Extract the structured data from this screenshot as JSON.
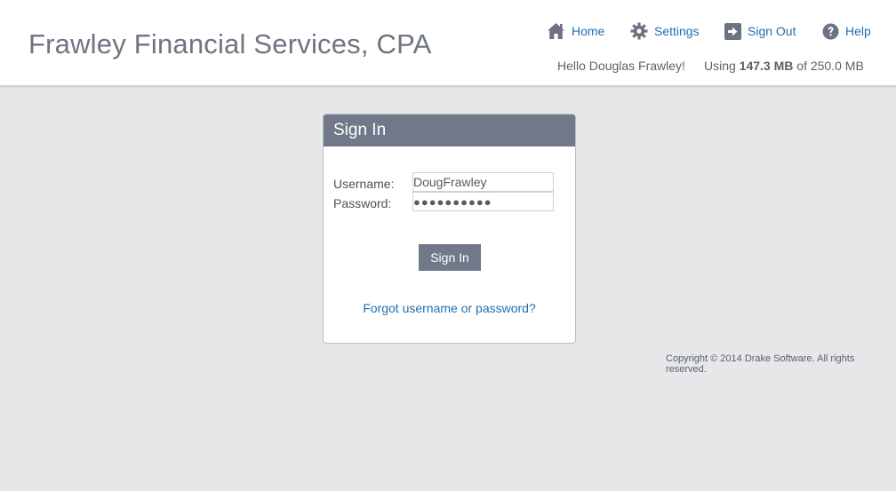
{
  "header": {
    "firm_name": "Frawley Financial Services, CPA",
    "greeting": "Hello Douglas Frawley!",
    "usage": {
      "prefix": "Using",
      "used": "147.3 MB",
      "middle": "of",
      "total": "250.0 MB"
    }
  },
  "nav": {
    "home": {
      "label": "Home",
      "icon": "home-icon"
    },
    "settings": {
      "label": "Settings",
      "icon": "gear-icon"
    },
    "signout": {
      "label": "Sign Out",
      "icon": "sign-out-icon"
    },
    "help": {
      "label": "Help",
      "icon": "help-icon"
    }
  },
  "signin": {
    "title": "Sign In",
    "username_label": "Username:",
    "username_value": "DougFrawley",
    "password_label": "Password:",
    "password_value": "●●●●●●●●●●",
    "button_label": "Sign In",
    "forgot_link": "Forgot username or password?"
  },
  "footer": {
    "copyright": "Copyright © 2014 Drake Software. All rights reserved."
  },
  "colors": {
    "brand_text": "#6e7480",
    "link": "#1f6fb1",
    "panel_header": "#71788a",
    "background": "#e6e7e9"
  }
}
